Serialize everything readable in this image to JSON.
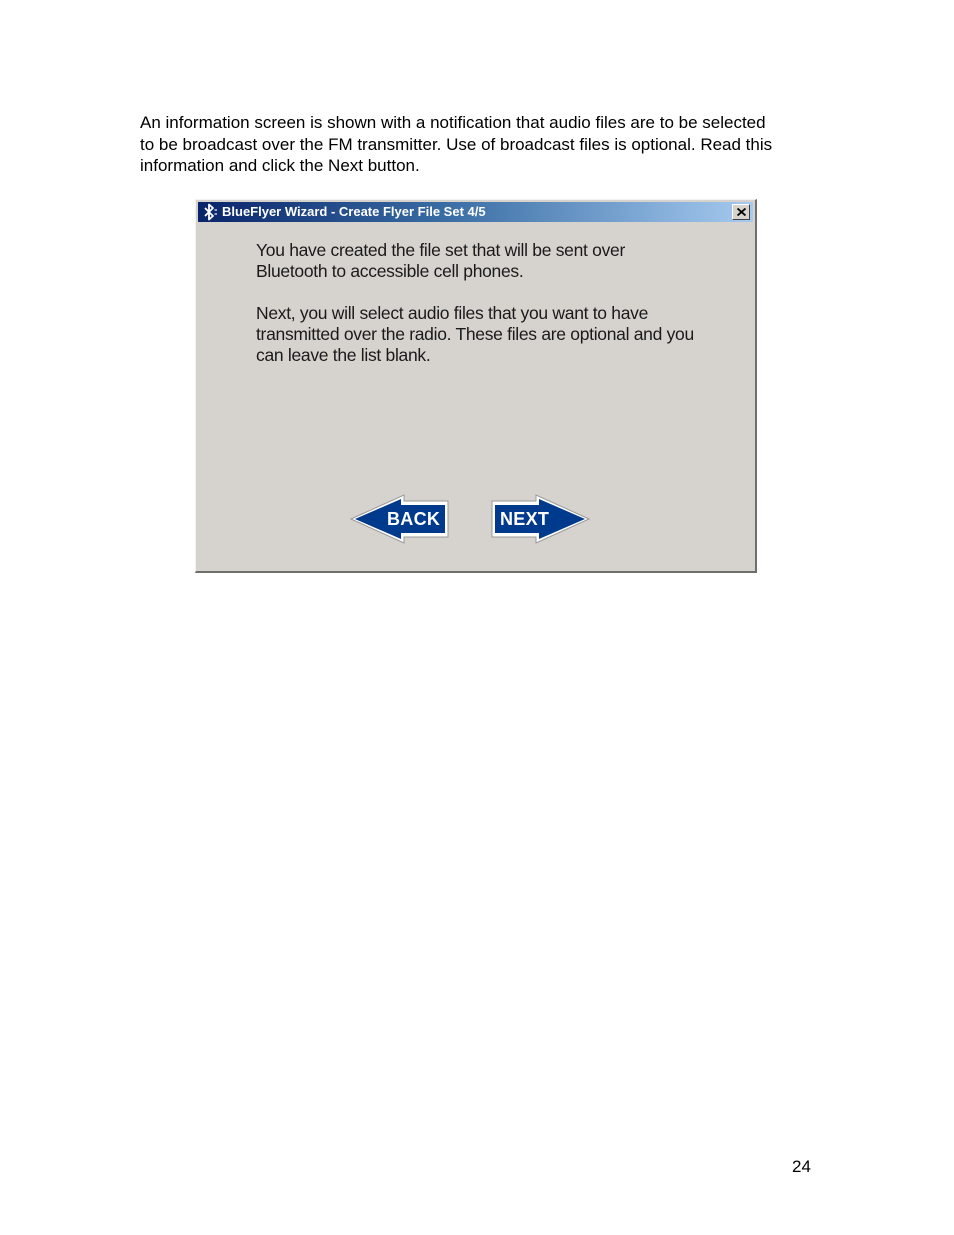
{
  "intro": {
    "text": "An information screen is shown with a notification that audio files are to be selected to be broadcast over the FM transmitter.  Use of broadcast files is optional. Read this information and click the Next button."
  },
  "dialog": {
    "title": "BlueFlyer Wizard - Create Flyer File Set 4/5",
    "paragraph1": "You have created the file set that will be sent over Bluetooth to accessible cell phones.",
    "paragraph2": "Next, you will select audio files that you want to have transmitted over the radio.  These files are optional and you can leave the list blank.",
    "back_label": "BACK",
    "next_label": "NEXT",
    "icons": {
      "title": "bluetooth-icon",
      "close": "close-icon",
      "back": "arrow-left-icon",
      "next": "arrow-right-icon"
    },
    "colors": {
      "button_fill": "#003a8c",
      "titlebar_start": "#0a246a",
      "titlebar_end": "#a6caf0",
      "dialog_bg": "#d6d3ce"
    }
  },
  "page_number": "24"
}
